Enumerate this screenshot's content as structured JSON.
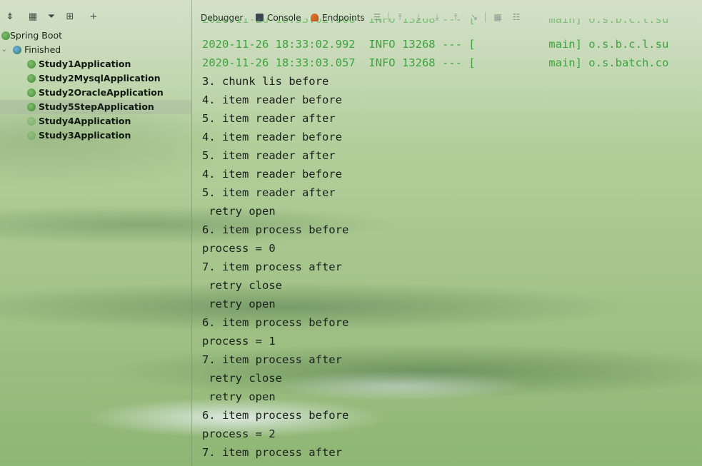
{
  "sidebar": {
    "tree": {
      "root": "Spring Boot",
      "group": "Finished",
      "apps": [
        "Study1Application",
        "Study2MysqlApplication",
        "Study2OracleApplication",
        "Study5StepApplication",
        "Study4Application",
        "Study3Application"
      ],
      "selected_app": "Study5StepApplication"
    }
  },
  "tabs": [
    {
      "label": "Debugger",
      "icon": "debugger-icon"
    },
    {
      "label": "Console",
      "icon": "console-icon"
    },
    {
      "label": "Endpoints",
      "icon": "endpoints-icon"
    }
  ],
  "colors": {
    "log_green": "#3da33d",
    "text": "#1a1f1c"
  },
  "console": {
    "log_lines": [
      {
        "ts": "2020-11-26 18:33:02.992",
        "level": "INFO 13268 --- [",
        "thread": "main]",
        "logger": "o.s.b.c.l.su"
      },
      {
        "ts": "2020-11-26 18:33:03.057",
        "level": "INFO 13268 --- [",
        "thread": "main]",
        "logger": "o.s.batch.co"
      }
    ],
    "lines": [
      "3. chunk lis before",
      "4. item reader before",
      "5. item reader after",
      "4. item reader before",
      "5. item reader after",
      "4. item reader before",
      "5. item reader after",
      " retry open",
      "6. item process before",
      "process = 0",
      "7. item process after",
      " retry close",
      " retry open",
      "6. item process before",
      "process = 1",
      "7. item process after",
      " retry close",
      " retry open",
      "6. item process before",
      "process = 2",
      "7. item process after"
    ]
  }
}
